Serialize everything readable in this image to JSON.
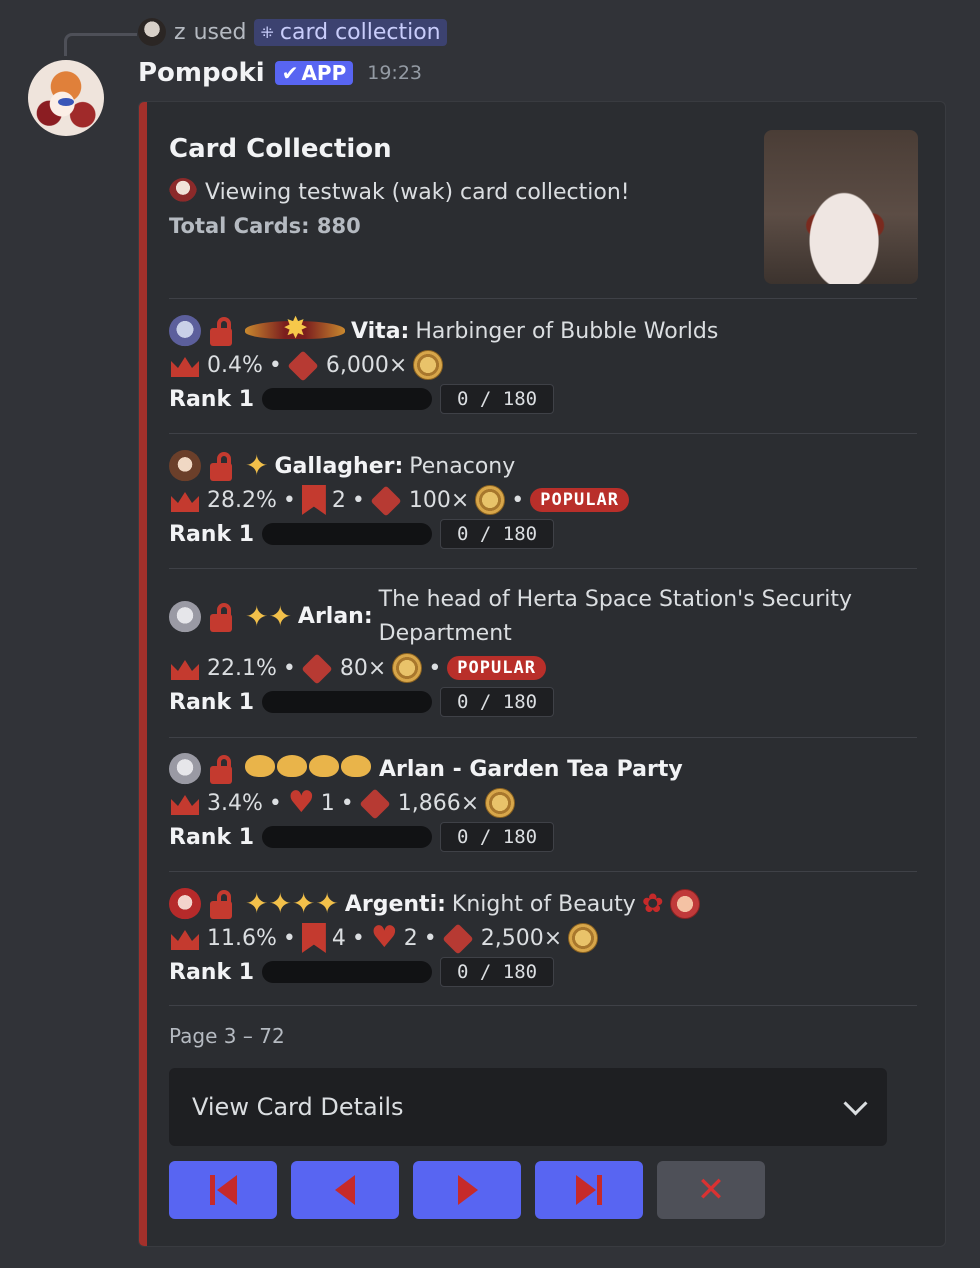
{
  "reply": {
    "user": "z",
    "action": "used",
    "command": "card collection"
  },
  "message": {
    "bot_name": "Pompoki",
    "app_tag": "APP",
    "time": "19:23"
  },
  "embed": {
    "title": "Card Collection",
    "description": "Viewing testwak (wak) card collection!",
    "total": "Total Cards: 880",
    "footer": "Page 3 – 72",
    "accent_color": "#a3302b"
  },
  "cards": [
    {
      "name": "Vita:",
      "subtitle": "Harbinger of Bubble Worlds",
      "percent": "0.4%",
      "price": "6,000×",
      "rank": "Rank 1",
      "progress": "0 / 180",
      "progress_fraction": 0
    },
    {
      "name": "Gallagher:",
      "subtitle": "Penacony",
      "percent": "28.2%",
      "bookmarks": "2",
      "price": "100×",
      "badge": "POPULAR",
      "rank": "Rank 1",
      "progress": "0 / 180",
      "progress_fraction": 0
    },
    {
      "name": "Arlan:",
      "subtitle": "The head of Herta Space Station's Security Department",
      "percent": "22.1%",
      "price": "80×",
      "badge": "POPULAR",
      "rank": "Rank 1",
      "progress": "0 / 180",
      "progress_fraction": 0
    },
    {
      "name": "Arlan - Garden Tea Party",
      "percent": "3.4%",
      "hearts": "1",
      "price": "1,866×",
      "rank": "Rank 1",
      "progress": "0 / 180",
      "progress_fraction": 0
    },
    {
      "name": "Argenti:",
      "subtitle": "Knight of Beauty",
      "percent": "11.6%",
      "bookmarks": "4",
      "hearts": "2",
      "price": "2,500×",
      "rank": "Rank 1",
      "progress": "0 / 180",
      "progress_fraction": 0
    }
  ],
  "select": {
    "placeholder": "View Card Details"
  },
  "buttons": [
    {
      "icon": "first-page-icon"
    },
    {
      "icon": "previous-page-icon"
    },
    {
      "icon": "next-page-icon"
    },
    {
      "icon": "last-page-icon"
    },
    {
      "icon": "close-icon"
    }
  ],
  "separator": "•"
}
